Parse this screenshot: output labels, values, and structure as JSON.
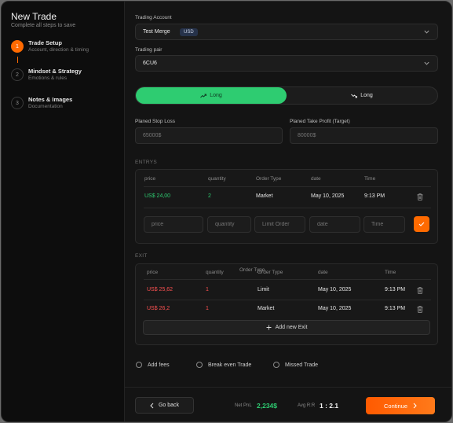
{
  "header": {
    "title": "New Trade",
    "subtitle": "Complete all steps to save"
  },
  "steps": [
    {
      "num": "1",
      "title": "Trade Setup",
      "desc": "Account, direction & timing",
      "active": true
    },
    {
      "num": "2",
      "title": "Mindset & Strategy",
      "desc": "Emotions & rules",
      "active": false
    },
    {
      "num": "3",
      "title": "Notes & Images",
      "desc": "Documentation",
      "active": false
    }
  ],
  "form": {
    "account_label": "Trading Account",
    "account_value": "Test Merge",
    "account_currency": "USD",
    "pair_label": "Trading pair",
    "pair_value": "6CU6",
    "direction_long": "Long",
    "direction_short": "Long",
    "stop_loss_label": "Planed Stop Loss",
    "stop_loss_placeholder": "65000$",
    "take_profit_label": "Planed Take Profit (Target)",
    "take_profit_placeholder": "80000$"
  },
  "entries": {
    "section_label": "ENTRYS",
    "headers": [
      "price",
      "quantity",
      "Order Type",
      "date",
      "Time"
    ],
    "rows": [
      {
        "price": "US$ 24,00",
        "quantity": "2",
        "order_type": "Market",
        "date": "May 10, 2025",
        "time": "9:13 PM"
      }
    ],
    "new_row_placeholders": {
      "price": "price",
      "quantity": "quantity",
      "order_type": "Limit Order",
      "date": "date",
      "time": "Time"
    }
  },
  "exits": {
    "section_label": "EXIT",
    "headers": [
      "price",
      "quantity",
      "Order Type",
      "date",
      "Time"
    ],
    "header_overlap": "Order Type",
    "rows": [
      {
        "price": "US$ 25,62",
        "quantity": "1",
        "order_type": "Limit",
        "date": "May 10, 2025",
        "time": "9:13 PM"
      },
      {
        "price": "US$ 26,2",
        "quantity": "1",
        "order_type": "Market",
        "date": "May 10, 2025",
        "time": "9:13 PM"
      }
    ],
    "add_label": "Add new Exit"
  },
  "options": {
    "add_fees": "Add fees",
    "break_even": "Break even Trade",
    "missed": "Missed Trade"
  },
  "footer": {
    "back_label": "Go back",
    "net_pnl_label": "Net PnL",
    "net_pnl_value": "2,234$",
    "avg_rr_label": "Avg R:R",
    "avg_rr_value": "1 : 2.1",
    "continue_label": "Continue"
  },
  "colors": {
    "accent": "#ff6a00",
    "positive": "#2ecc71",
    "negative": "#ff5252",
    "background": "#0d0d0d"
  },
  "icons": [
    "chevron-down-icon",
    "trend-up-icon",
    "trend-down-icon",
    "trash-icon",
    "check-icon",
    "plus-icon",
    "chevron-left-icon",
    "chevron-right-icon"
  ]
}
